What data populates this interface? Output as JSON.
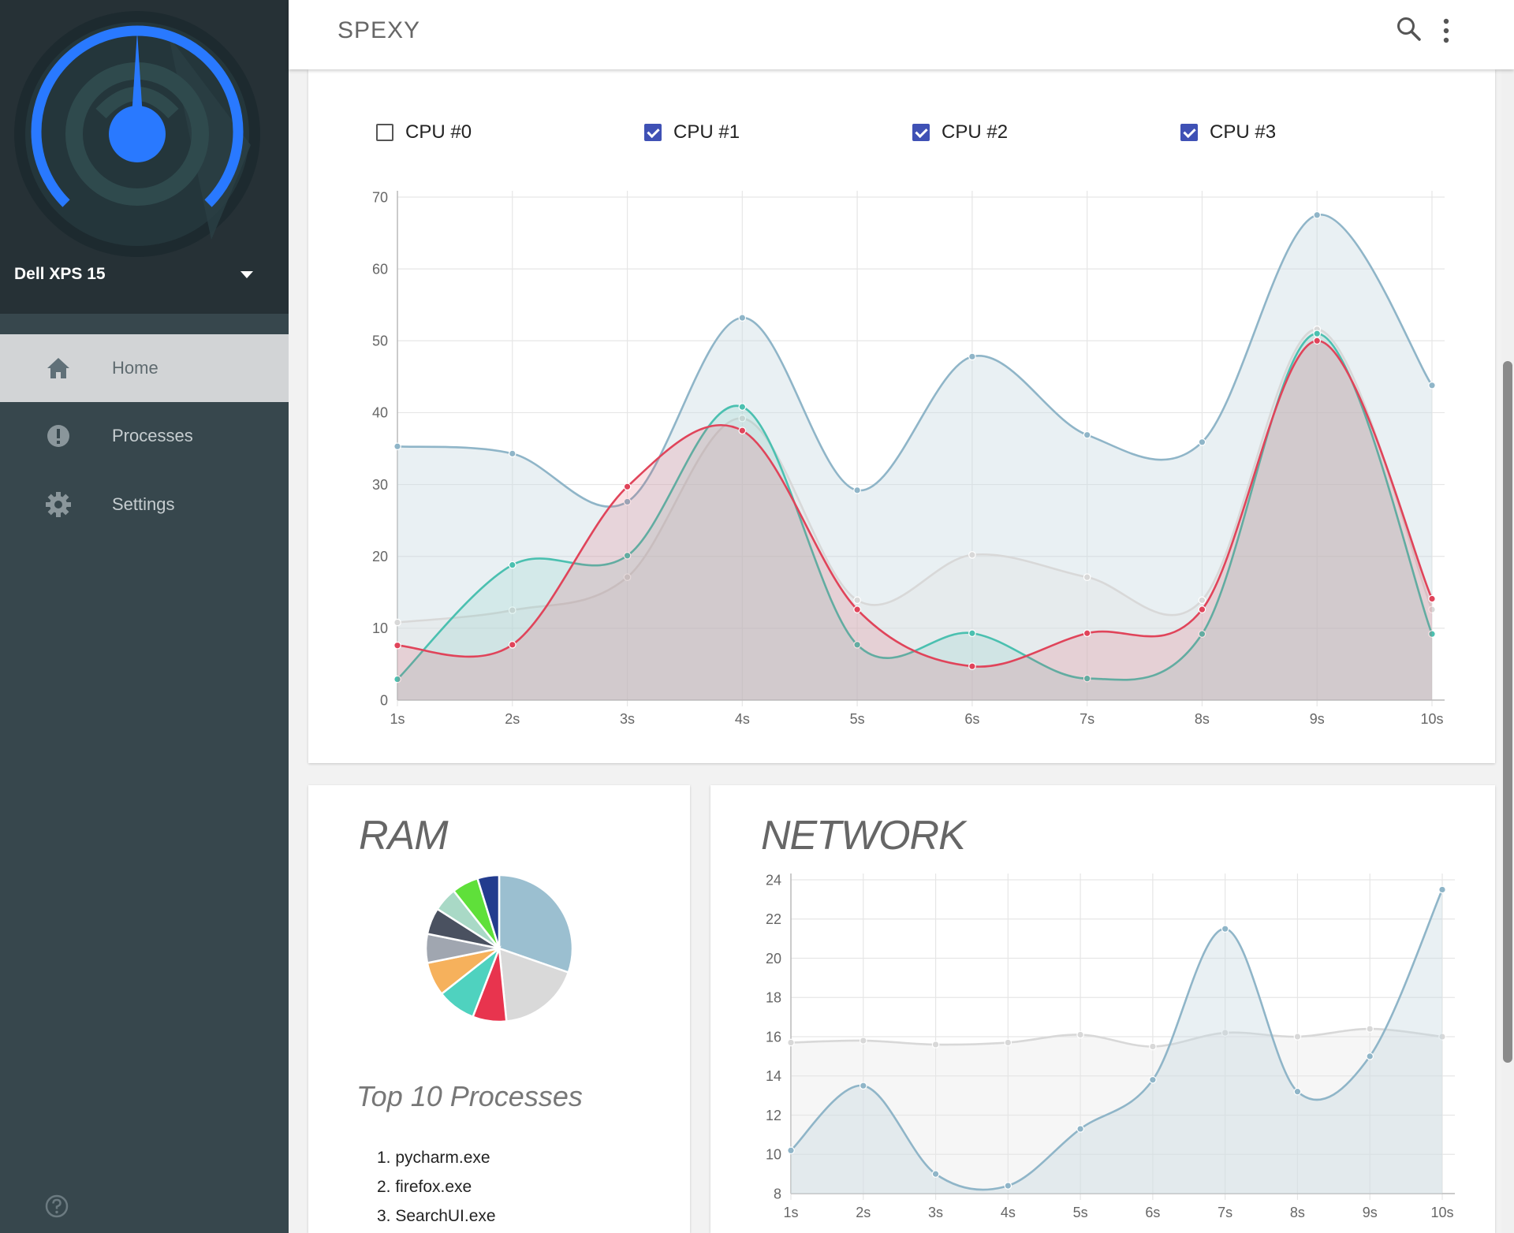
{
  "app": {
    "title": "SPEXY"
  },
  "sidebar": {
    "device_name": "Dell XPS 15",
    "items": [
      {
        "label": "Home",
        "icon": "home-icon",
        "active": true
      },
      {
        "label": "Processes",
        "icon": "alert-circle-icon",
        "active": false
      },
      {
        "label": "Settings",
        "icon": "gear-icon",
        "active": false
      }
    ]
  },
  "colors": {
    "accent": "#2979ff",
    "sidebar_bg": "#37474d",
    "sidebar_header_bg": "#263136",
    "checkbox": "#3f51b5",
    "series_blue": "#8fb5c8",
    "series_teal": "#4bc0b0",
    "series_red": "#e0445a",
    "series_grey": "#d6d6d6"
  },
  "cpu": {
    "toggles": [
      {
        "label": "CPU #0",
        "checked": false
      },
      {
        "label": "CPU #1",
        "checked": true
      },
      {
        "label": "CPU #2",
        "checked": true
      },
      {
        "label": "CPU #3",
        "checked": true
      }
    ]
  },
  "ram": {
    "title": "RAM",
    "top_title": "Top 10 Processes",
    "processes": [
      "1. pycharm.exe",
      "2. firefox.exe",
      "3. SearchUI.exe"
    ]
  },
  "network": {
    "title": "NETWORK"
  },
  "chart_data": [
    {
      "id": "cpu",
      "type": "area",
      "x": [
        "1s",
        "2s",
        "3s",
        "4s",
        "5s",
        "6s",
        "7s",
        "8s",
        "9s",
        "10s"
      ],
      "ylim": [
        0,
        70
      ],
      "yticks": [
        0,
        10,
        20,
        30,
        40,
        50,
        60,
        70
      ],
      "grid": true,
      "series": [
        {
          "color": "#8fb5c8",
          "fill": "rgba(200,218,226,0.40)",
          "values": [
            35.3,
            34.3,
            27.6,
            53.2,
            29.2,
            47.8,
            36.9,
            35.9,
            67.5,
            43.8
          ]
        },
        {
          "color": "#d8d8d8",
          "fill": "rgba(225,225,225,0.30)",
          "values": [
            10.8,
            12.5,
            17.1,
            39.2,
            13.9,
            20.2,
            17.1,
            13.9,
            51.6,
            12.6
          ]
        },
        {
          "color": "#4bc0b0",
          "fill": "rgba(75,192,176,0.14)",
          "values": [
            2.9,
            18.8,
            20.1,
            40.8,
            7.7,
            9.3,
            3.0,
            9.2,
            51.0,
            9.2
          ]
        },
        {
          "color": "#e0445a",
          "fill": "rgba(224,68,90,0.16)",
          "values": [
            7.6,
            7.7,
            29.7,
            37.5,
            12.6,
            4.7,
            9.3,
            12.6,
            50.0,
            14.1
          ]
        }
      ]
    },
    {
      "id": "network",
      "type": "area",
      "x": [
        "1s",
        "2s",
        "3s",
        "4s",
        "5s",
        "6s",
        "7s",
        "8s",
        "9s",
        "10s"
      ],
      "ylim": [
        8,
        24
      ],
      "yticks": [
        8,
        10,
        12,
        14,
        16,
        18,
        20,
        22,
        24
      ],
      "grid": true,
      "series": [
        {
          "color": "#d8d8d8",
          "fill": "rgba(230,230,230,0.35)",
          "values": [
            15.7,
            15.8,
            15.6,
            15.7,
            16.1,
            15.5,
            16.2,
            16.0,
            16.4,
            16.0
          ]
        },
        {
          "color": "#8fb5c8",
          "fill": "rgba(200,218,226,0.40)",
          "values": [
            10.2,
            13.5,
            9.0,
            8.4,
            11.3,
            13.8,
            21.5,
            13.2,
            15.0,
            23.5
          ]
        }
      ]
    },
    {
      "id": "ram",
      "type": "pie",
      "slices": [
        {
          "value": 28.5,
          "color": "#9bbfd0"
        },
        {
          "value": 17.0,
          "color": "#d9d9d9"
        },
        {
          "value": 7.0,
          "color": "#e8344e"
        },
        {
          "value": 8.0,
          "color": "#4fd2bf"
        },
        {
          "value": 7.0,
          "color": "#f6b15c"
        },
        {
          "value": 6.0,
          "color": "#a0a6b0"
        },
        {
          "value": 5.5,
          "color": "#4a5160"
        },
        {
          "value": 5.0,
          "color": "#a9d9c6"
        },
        {
          "value": 5.5,
          "color": "#5fe03a"
        },
        {
          "value": 4.5,
          "color": "#233c8e"
        }
      ]
    }
  ]
}
